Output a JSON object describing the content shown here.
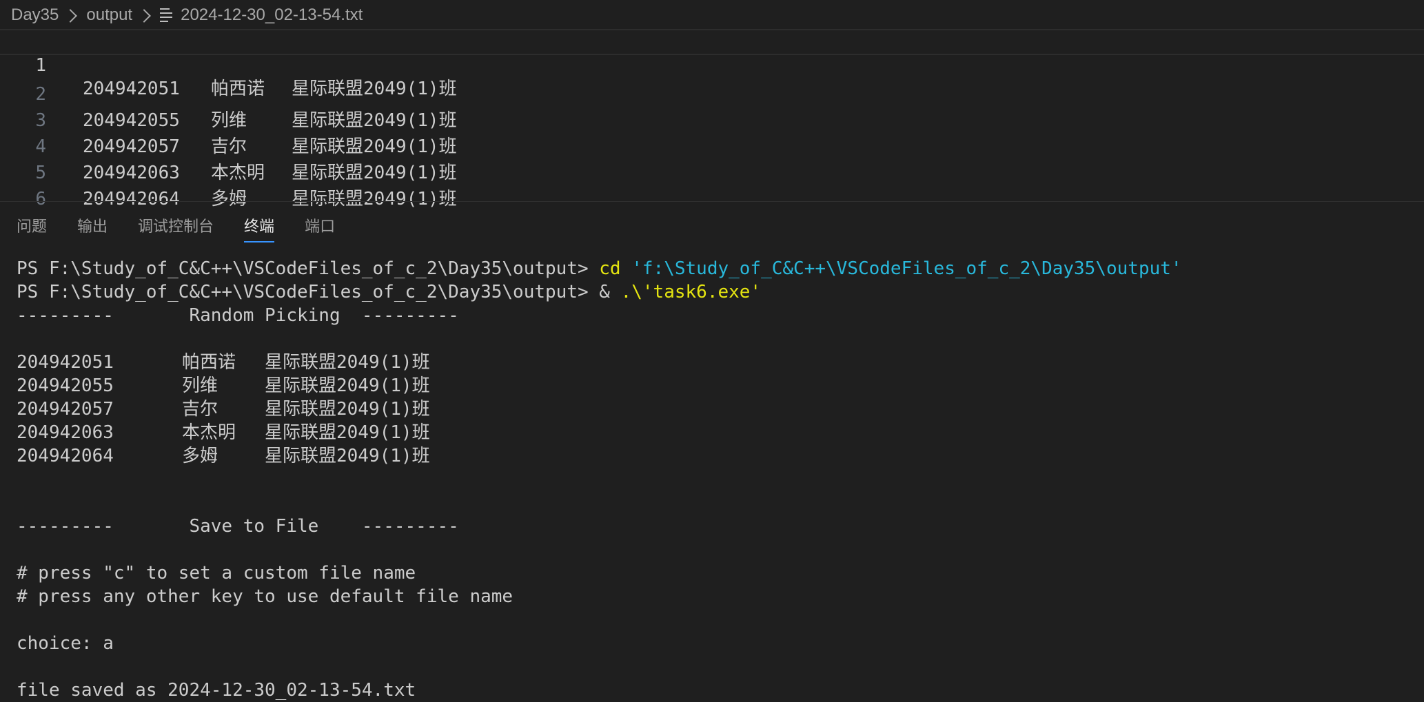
{
  "breadcrumb": {
    "folder1": "Day35",
    "folder2": "output",
    "file": "2024-12-30_02-13-54.txt"
  },
  "editor": {
    "lines": [
      {
        "num": "1",
        "id": "204942051",
        "name": "帕西诺",
        "cls": "星际联盟2049(1)班"
      },
      {
        "num": "2",
        "id": "204942055",
        "name": "列维",
        "cls": "星际联盟2049(1)班"
      },
      {
        "num": "3",
        "id": "204942057",
        "name": "吉尔",
        "cls": "星际联盟2049(1)班"
      },
      {
        "num": "4",
        "id": "204942063",
        "name": "本杰明",
        "cls": "星际联盟2049(1)班"
      },
      {
        "num": "5",
        "id": "204942064",
        "name": "多姆",
        "cls": "星际联盟2049(1)班"
      },
      {
        "num": "6",
        "id": "",
        "name": "",
        "cls": ""
      }
    ]
  },
  "panel": {
    "tabs": [
      "问题",
      "输出",
      "调试控制台",
      "终端",
      "端口"
    ],
    "active_tab": "终端"
  },
  "terminal": {
    "prompt": "PS F:\\Study_of_C&C++\\VSCodeFiles_of_c_2\\Day35\\output> ",
    "cmd1_keyword": "cd",
    "cmd1_arg": " 'f:\\Study_of_C&C++\\VSCodeFiles_of_c_2\\Day35\\output'",
    "cmd2_op": "& ",
    "cmd2_arg": ".\\'task6.exe'",
    "header_random": "---------       Random Picking  ---------",
    "records": [
      {
        "id": "204942051",
        "name": "帕西诺",
        "cls": "星际联盟2049(1)班"
      },
      {
        "id": "204942055",
        "name": "列维",
        "cls": "星际联盟2049(1)班"
      },
      {
        "id": "204942057",
        "name": "吉尔",
        "cls": "星际联盟2049(1)班"
      },
      {
        "id": "204942063",
        "name": "本杰明",
        "cls": "星际联盟2049(1)班"
      },
      {
        "id": "204942064",
        "name": "多姆",
        "cls": "星际联盟2049(1)班"
      }
    ],
    "header_save": "---------       Save to File    ---------",
    "hint1": "# press \"c\" to set a custom file name",
    "hint2": "# press any other key to use default file name",
    "choice": "choice: a",
    "saved": "file saved as 2024-12-30_02-13-54.txt"
  },
  "colors": {
    "background": "#1f1f1f",
    "text": "#cccccc",
    "command_yellow": "#e5e510",
    "string_cyan": "#29b8db",
    "tab_underline": "#3794ff"
  }
}
